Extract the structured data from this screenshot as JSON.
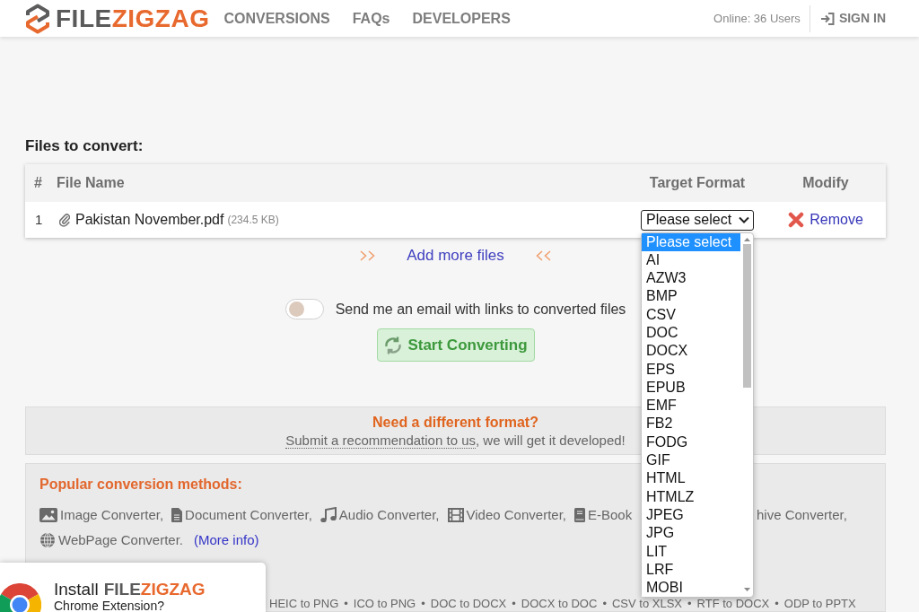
{
  "header": {
    "logo": {
      "prefix": "FILE",
      "accent": "ZIGZAG"
    },
    "nav": [
      {
        "label": "CONVERSIONS"
      },
      {
        "label": "FAQs"
      },
      {
        "label": "DEVELOPERS"
      }
    ],
    "online": "Online: 36 Users",
    "sign_in": "SIGN IN"
  },
  "files": {
    "title": "Files to convert:",
    "columns": [
      "#",
      "File Name",
      "Target Format",
      "Modify"
    ],
    "rows": [
      {
        "index": "1",
        "name": "Pakistan November.pdf",
        "size": "(234.5 KB)",
        "target": "Please select",
        "action": "Remove"
      }
    ]
  },
  "add_more": "Add more files",
  "email_toggle": {
    "label": "Send me an email with links to converted files",
    "on": false
  },
  "start_button": "Start Converting",
  "format_request": {
    "title": "Need a different format?",
    "link": "Submit a recommendation to us",
    "rest": ", we will get it developed!"
  },
  "popular": {
    "title": "Popular conversion methods:",
    "lines": [
      [
        {
          "kind": "image",
          "label": "Image Converter,"
        },
        {
          "kind": "document",
          "label": "Document Converter,"
        },
        {
          "kind": "audio",
          "label": "Audio Converter,"
        },
        {
          "kind": "video",
          "label": "Video Converter,"
        },
        {
          "kind": "ebook",
          "label": "E-Book"
        },
        {
          "kind": "covered",
          "label": "hive Converter,"
        }
      ],
      [
        {
          "kind": "web",
          "label": "WebPage Converter."
        },
        {
          "kind": "more",
          "label": "(More info)"
        }
      ]
    ],
    "conversions": [
      "HEIC to PNG",
      "ICO to PNG",
      "DOC to DOCX",
      "DOCX to DOC",
      "CSV to XLSX",
      "RTF to DOCX",
      "ODP to PPTX"
    ],
    "separator": "•"
  },
  "format_dropdown": {
    "options": [
      {
        "label": "Please select",
        "selected": true
      },
      {
        "label": "AI",
        "selected": false
      },
      {
        "label": "AZW3",
        "selected": false
      },
      {
        "label": "BMP",
        "selected": false
      },
      {
        "label": "CSV",
        "selected": false
      },
      {
        "label": "DOC",
        "selected": false
      },
      {
        "label": "DOCX",
        "selected": false
      },
      {
        "label": "EPS",
        "selected": false
      },
      {
        "label": "EPUB",
        "selected": false
      },
      {
        "label": "EMF",
        "selected": false
      },
      {
        "label": "FB2",
        "selected": false
      },
      {
        "label": "FODG",
        "selected": false
      },
      {
        "label": "GIF",
        "selected": false
      },
      {
        "label": "HTML",
        "selected": false
      },
      {
        "label": "HTMLZ",
        "selected": false
      },
      {
        "label": "JPEG",
        "selected": false
      },
      {
        "label": "JPG",
        "selected": false
      },
      {
        "label": "LIT",
        "selected": false
      },
      {
        "label": "LRF",
        "selected": false
      },
      {
        "label": "MOBI",
        "selected": false
      }
    ]
  },
  "extension_prompt": {
    "title": "Install",
    "brand_prefix": "FILE",
    "brand_accent": "ZIGZAG",
    "subtitle": "Chrome Extension?"
  }
}
